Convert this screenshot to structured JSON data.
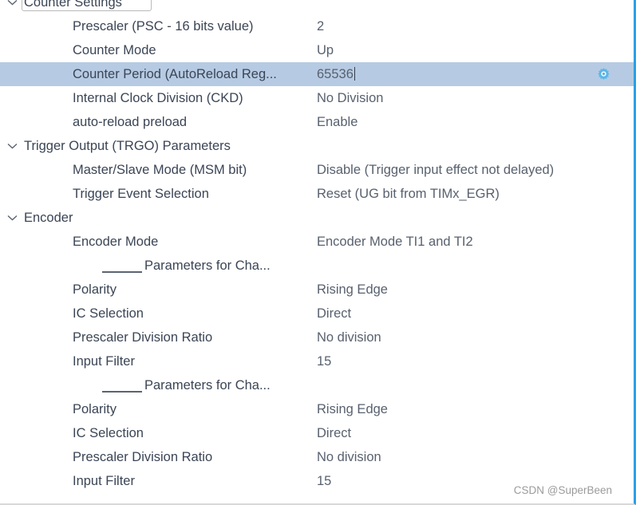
{
  "panel": {
    "accent_color": "#29a0e8",
    "selection_color": "#b6cbe3",
    "label_color": "#3b4555",
    "value_color": "#58616e"
  },
  "watermark": "CSDN @SuperBeen",
  "groups": [
    {
      "name": "counter-settings",
      "header": "Counter Settings",
      "expanded_icon": "chevron-down-icon",
      "clipped": true,
      "focused": true,
      "rows": [
        {
          "label": "Prescaler (PSC - 16 bits value)",
          "value": "2",
          "selected": false
        },
        {
          "label": "Counter Mode",
          "value": "Up",
          "selected": false
        },
        {
          "label": "Counter Period (AutoReload Reg...",
          "value": "65536",
          "selected": true,
          "editing": true,
          "has_gear": true
        },
        {
          "label": "Internal Clock Division (CKD)",
          "value": "No Division",
          "selected": false
        },
        {
          "label": "auto-reload preload",
          "value": "Enable",
          "selected": false
        }
      ]
    },
    {
      "name": "trigger-output-parameters",
      "header": "Trigger Output (TRGO) Parameters",
      "expanded_icon": "chevron-down-icon",
      "rows": [
        {
          "label": "Master/Slave Mode (MSM bit)",
          "value": "Disable (Trigger input effect not delayed)",
          "selected": false
        },
        {
          "label": "Trigger Event Selection",
          "value": "Reset (UG bit from TIMx_EGR)",
          "selected": false
        }
      ]
    },
    {
      "name": "encoder",
      "header": "Encoder",
      "expanded_icon": "chevron-down-icon",
      "rows": [
        {
          "label": "Encoder Mode",
          "value": "Encoder Mode TI1 and TI2",
          "selected": false
        },
        {
          "subheader": "Parameters for Cha...",
          "value": "",
          "selected": false
        },
        {
          "label": "Polarity",
          "value": "Rising Edge",
          "selected": false
        },
        {
          "label": "IC Selection",
          "value": "Direct",
          "selected": false
        },
        {
          "label": "Prescaler Division Ratio",
          "value": "No division",
          "selected": false
        },
        {
          "label": "Input Filter",
          "value": "15",
          "selected": false
        },
        {
          "subheader": "Parameters for Cha...",
          "value": "",
          "selected": false
        },
        {
          "label": "Polarity",
          "value": "Rising Edge",
          "selected": false
        },
        {
          "label": "IC Selection",
          "value": "Direct",
          "selected": false
        },
        {
          "label": "Prescaler Division Ratio",
          "value": "No division",
          "selected": false
        },
        {
          "label": "Input Filter",
          "value": "15",
          "selected": false
        }
      ]
    }
  ]
}
